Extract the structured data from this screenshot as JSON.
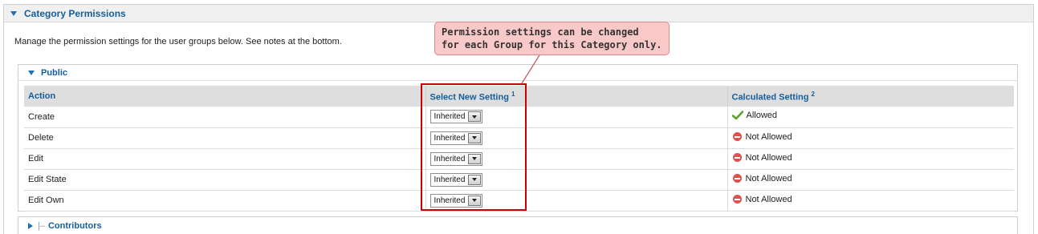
{
  "panel": {
    "title": "Category Permissions"
  },
  "description": "Manage the permission settings for the user groups below. See notes at the bottom.",
  "groups": {
    "public": {
      "title": "Public"
    },
    "contributors": {
      "prefix": "|–",
      "title": "Contributors"
    }
  },
  "table": {
    "headers": {
      "action": "Action",
      "select": "Select New Setting",
      "select_note": "1",
      "calculated": "Calculated Setting",
      "calculated_note": "2"
    },
    "rows": [
      {
        "action": "Create",
        "setting": "Inherited",
        "calculated": "Allowed",
        "status_icon": "check-icon"
      },
      {
        "action": "Delete",
        "setting": "Inherited",
        "calculated": "Not Allowed",
        "status_icon": "no-entry-icon"
      },
      {
        "action": "Edit",
        "setting": "Inherited",
        "calculated": "Not Allowed",
        "status_icon": "no-entry-icon"
      },
      {
        "action": "Edit State",
        "setting": "Inherited",
        "calculated": "Not Allowed",
        "status_icon": "no-entry-icon"
      },
      {
        "action": "Edit Own",
        "setting": "Inherited",
        "calculated": "Not Allowed",
        "status_icon": "no-entry-icon"
      }
    ]
  },
  "callout": {
    "line1": "Permission settings can be changed",
    "line2": "for each Group for this Category only."
  },
  "colors": {
    "link_blue": "#135f9e",
    "highlight_red": "#cc0000",
    "callout_bg": "#f9c9ca",
    "allowed_green": "#5aa02c",
    "denied_red": "#d9534f"
  }
}
